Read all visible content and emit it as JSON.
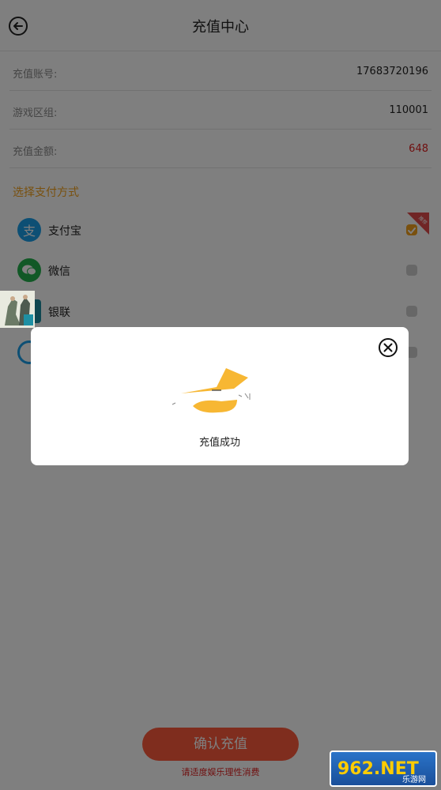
{
  "header": {
    "title": "充值中心"
  },
  "info_rows": [
    {
      "label": "充值账号:",
      "value": "17683720196"
    },
    {
      "label": "游戏区组:",
      "value": "110001"
    },
    {
      "label": "充值金额:",
      "value": "648"
    }
  ],
  "payment": {
    "title": "选择支付方式",
    "methods": [
      {
        "name": "支付宝",
        "icon": "alipay-icon",
        "checked": true
      },
      {
        "name": "微信",
        "icon": "wechat-icon",
        "checked": false
      },
      {
        "name": "银联",
        "icon": "unionpay-icon",
        "checked": false
      },
      {
        "name": "",
        "icon": "other-pay-icon",
        "checked": false
      }
    ],
    "recommend_flag": "推荐"
  },
  "confirm_button": "确认充值",
  "hint": "请适度娱乐理性消费",
  "modal": {
    "message": "充值成功"
  },
  "colors": {
    "accent": "#f2a11c",
    "confirm": "#ff5a3c",
    "alipay": "#1a9fe8",
    "wechat": "#22b14c",
    "unionpay": "#1e8fa3",
    "amount": "#e02020"
  },
  "watermark": {
    "text": "962.NET",
    "subtext": "乐游网"
  }
}
